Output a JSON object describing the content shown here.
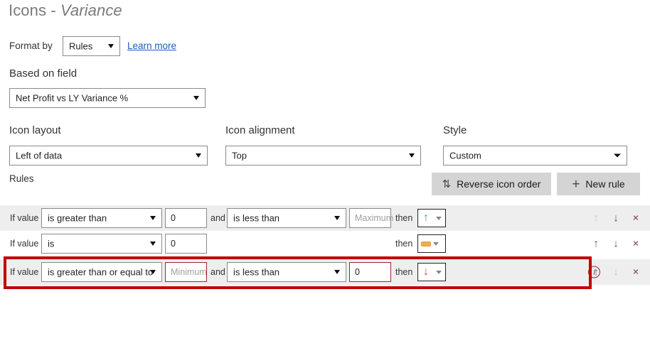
{
  "header": {
    "title_main": "Icons - ",
    "title_em": "Variance"
  },
  "format_by": {
    "label": "Format by",
    "value": "Rules",
    "learn_more": "Learn more"
  },
  "based_on_field": {
    "label": "Based on field",
    "value": "Net Profit vs LY Variance %"
  },
  "icon_layout": {
    "label": "Icon layout",
    "value": "Left of data"
  },
  "icon_alignment": {
    "label": "Icon alignment",
    "value": "Top"
  },
  "style": {
    "label": "Style",
    "value": "Custom"
  },
  "buttons": {
    "reverse_icon_order": "Reverse icon order",
    "reverse_glyph": "⇅",
    "new_rule": "New rule",
    "new_rule_glyph": "+"
  },
  "rules": {
    "label": "Rules",
    "if_value_label": "If value",
    "and_label": "and",
    "then_label": "then",
    "rows": [
      {
        "condition1": "is greater than",
        "value1": "0",
        "value1_placeholder": "",
        "has_second": true,
        "condition2": "is less than",
        "value2": "",
        "value2_placeholder": "Maximum",
        "icon": "arrow-up-green",
        "icon_glyph": "↑",
        "icon_color": "#3fae49",
        "error": false,
        "info": false,
        "move_up_enabled": false,
        "move_down_enabled": true
      },
      {
        "condition1": "is",
        "value1": "0",
        "value1_placeholder": "",
        "has_second": false,
        "condition2": "",
        "value2": "",
        "value2_placeholder": "",
        "icon": "dash-amber",
        "icon_glyph": "—",
        "icon_color": "#f0ad4e",
        "error": false,
        "info": false,
        "move_up_enabled": true,
        "move_down_enabled": true
      },
      {
        "condition1": "is greater than or equal to",
        "value1": "",
        "value1_placeholder": "Minimum",
        "has_second": true,
        "condition2": "is less than",
        "value2": "0",
        "value2_placeholder": "",
        "icon": "arrow-down-red",
        "icon_glyph": "↓",
        "icon_color": "#e8402a",
        "error": true,
        "info": true,
        "info_glyph": "i",
        "move_up_enabled": true,
        "move_down_enabled": false
      }
    ],
    "action_up_glyph": "↑",
    "action_down_glyph": "↓",
    "action_close_glyph": "×"
  },
  "colors": {
    "highlight_box": "#c00000",
    "error_border": "#a4262c",
    "link": "#1a5fb4",
    "row_shade": "#eeeeee",
    "button_bg": "#d4d4d4"
  }
}
